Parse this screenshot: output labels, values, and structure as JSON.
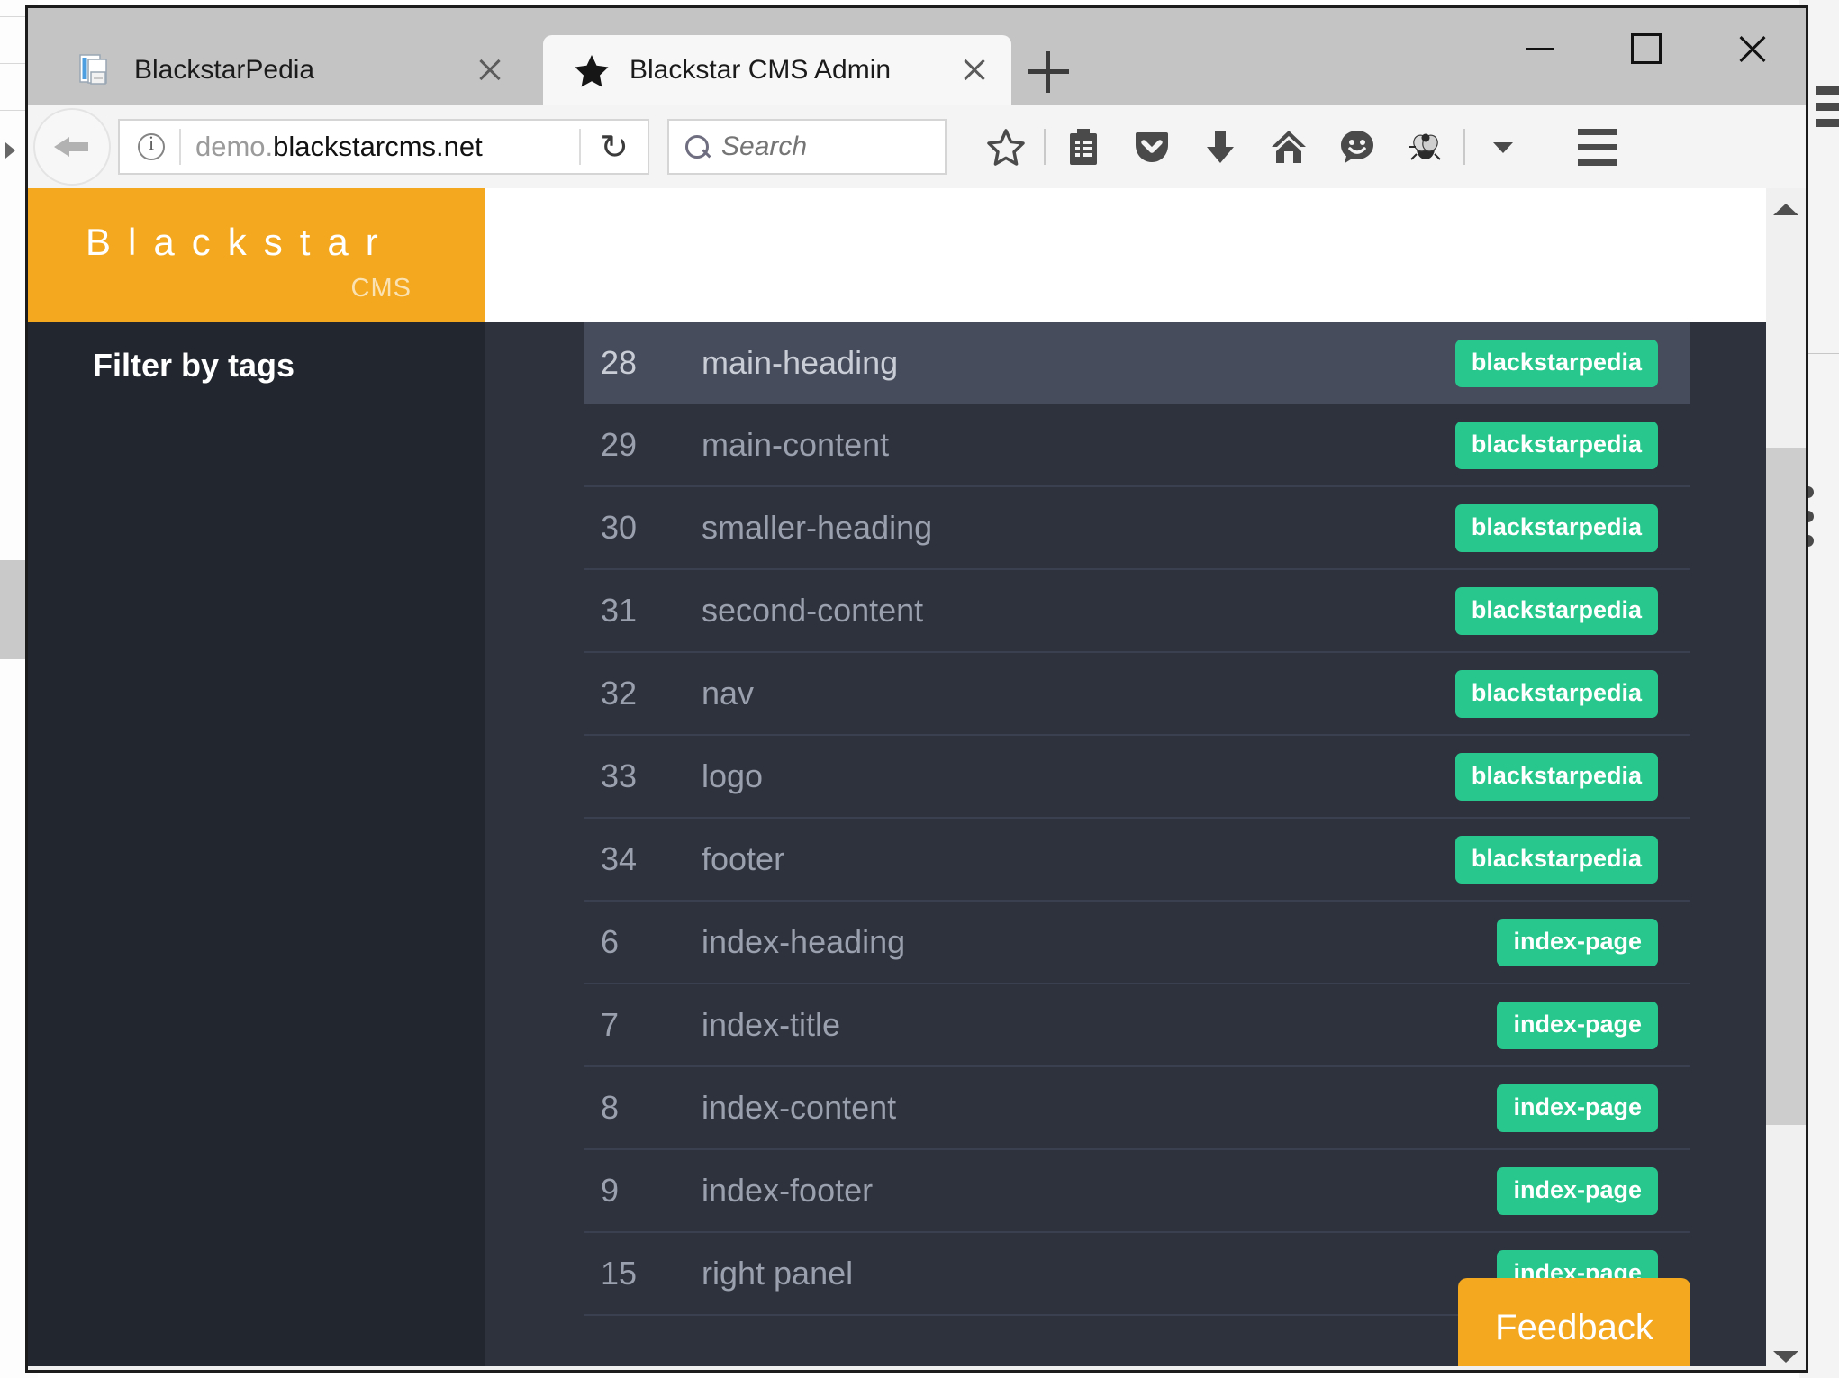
{
  "browser": {
    "window_controls": {
      "minimize": "minimize",
      "maximize": "maximize",
      "close": "close"
    },
    "tabs": [
      {
        "title": "BlackstarPedia",
        "favicon": "document-stack-icon",
        "active": false
      },
      {
        "title": "Blackstar CMS Admin",
        "favicon": "star-icon",
        "active": true
      }
    ],
    "new_tab_label": "+",
    "back_label": "Back",
    "identity_label": "i",
    "url": {
      "prefix": "demo.",
      "main": "blackstarcms.net",
      "full": "demo.blackstarcms.net"
    },
    "reload_label": "↻",
    "search": {
      "value": "",
      "placeholder": "Search"
    },
    "toolbar_icons": [
      {
        "name": "bookmark-star-icon",
        "glyph": "star"
      },
      {
        "name": "library-list-icon",
        "glyph": "library"
      },
      {
        "name": "pocket-icon",
        "glyph": "pocket"
      },
      {
        "name": "downloads-icon",
        "glyph": "download"
      },
      {
        "name": "home-icon",
        "glyph": "home"
      },
      {
        "name": "chat-smiley-icon",
        "glyph": "smiley"
      },
      {
        "name": "bug-icon",
        "glyph": "bug"
      },
      {
        "name": "overflow-chevron-down-icon",
        "glyph": "chevron-down"
      }
    ],
    "menu_label": "Open menu"
  },
  "app": {
    "sidebar": {
      "logo_word": "Blackstar",
      "logo_sub": "CMS",
      "filter_title": "Filter by tags"
    },
    "feedback_button": "Feedback",
    "table": {
      "rows": [
        {
          "id": "28",
          "name": "main-heading",
          "tags": [
            "blackstarpedia"
          ],
          "selected": true
        },
        {
          "id": "29",
          "name": "main-content",
          "tags": [
            "blackstarpedia"
          ],
          "selected": false
        },
        {
          "id": "30",
          "name": "smaller-heading",
          "tags": [
            "blackstarpedia"
          ],
          "selected": false
        },
        {
          "id": "31",
          "name": "second-content",
          "tags": [
            "blackstarpedia"
          ],
          "selected": false
        },
        {
          "id": "32",
          "name": "nav",
          "tags": [
            "blackstarpedia"
          ],
          "selected": false
        },
        {
          "id": "33",
          "name": "logo",
          "tags": [
            "blackstarpedia"
          ],
          "selected": false
        },
        {
          "id": "34",
          "name": "footer",
          "tags": [
            "blackstarpedia"
          ],
          "selected": false
        },
        {
          "id": "6",
          "name": "index-heading",
          "tags": [
            "index-page"
          ],
          "selected": false
        },
        {
          "id": "7",
          "name": "index-title",
          "tags": [
            "index-page"
          ],
          "selected": false
        },
        {
          "id": "8",
          "name": "index-content",
          "tags": [
            "index-page"
          ],
          "selected": false
        },
        {
          "id": "9",
          "name": "index-footer",
          "tags": [
            "index-page"
          ],
          "selected": false
        },
        {
          "id": "15",
          "name": "right panel",
          "tags": [
            "index-page"
          ],
          "selected": false
        }
      ]
    }
  },
  "colors": {
    "brand_orange": "#f3a81f",
    "tag_green": "#27c78d",
    "sidebar_dark": "#22262e",
    "content_dark": "#2e323d",
    "row_selected": "#474c5c",
    "row_text": "#9aa0ad"
  }
}
